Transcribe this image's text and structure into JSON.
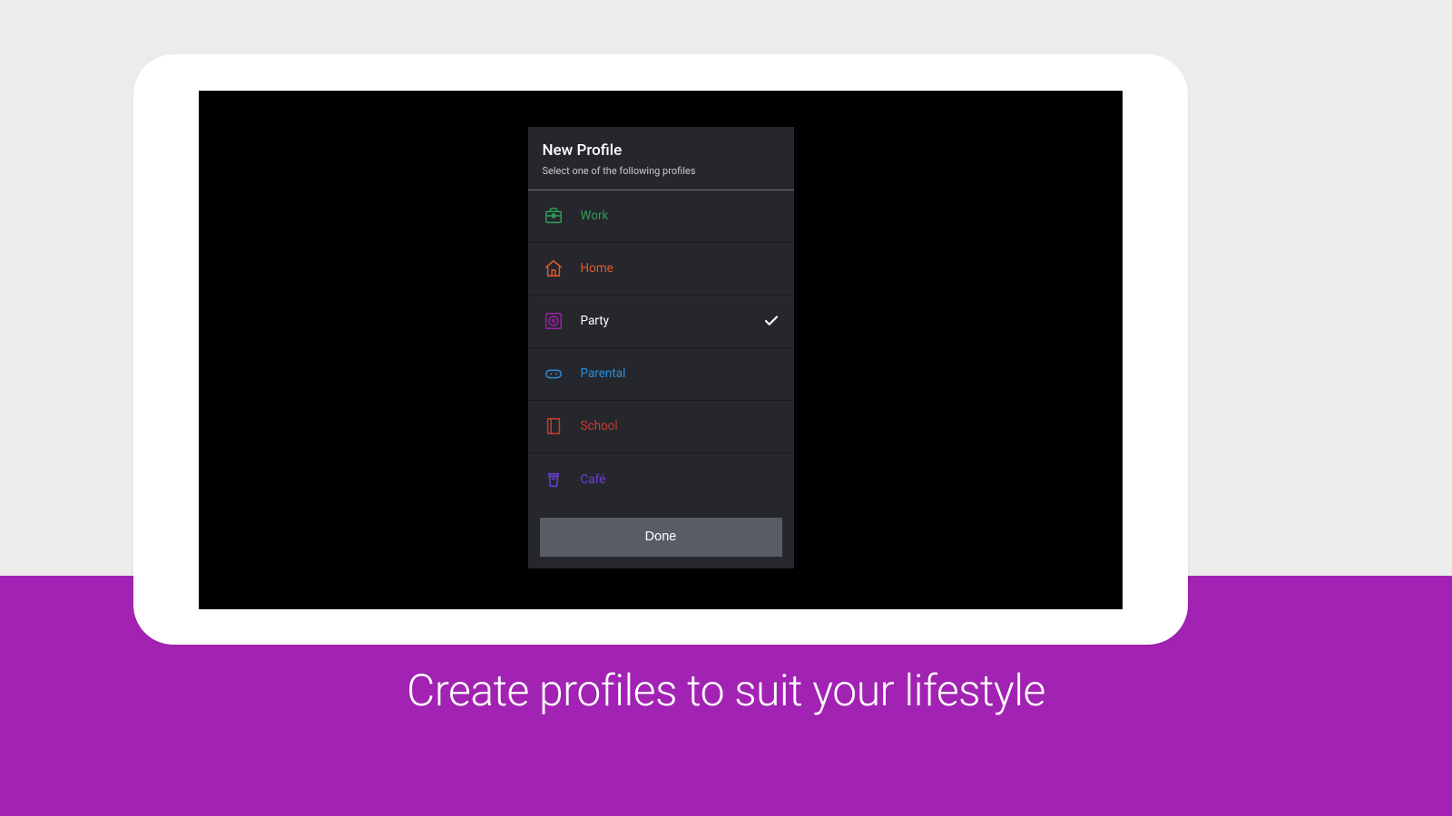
{
  "banner": {
    "headline": "Create profiles to suit your lifestyle"
  },
  "dialog": {
    "title": "New Profile",
    "subtitle": "Select one of the following profiles",
    "done_label": "Done",
    "items": [
      {
        "label": "Work",
        "selected": false
      },
      {
        "label": "Home",
        "selected": false
      },
      {
        "label": "Party",
        "selected": true
      },
      {
        "label": "Parental",
        "selected": false
      },
      {
        "label": "School",
        "selected": false
      },
      {
        "label": "Café",
        "selected": false
      }
    ]
  }
}
